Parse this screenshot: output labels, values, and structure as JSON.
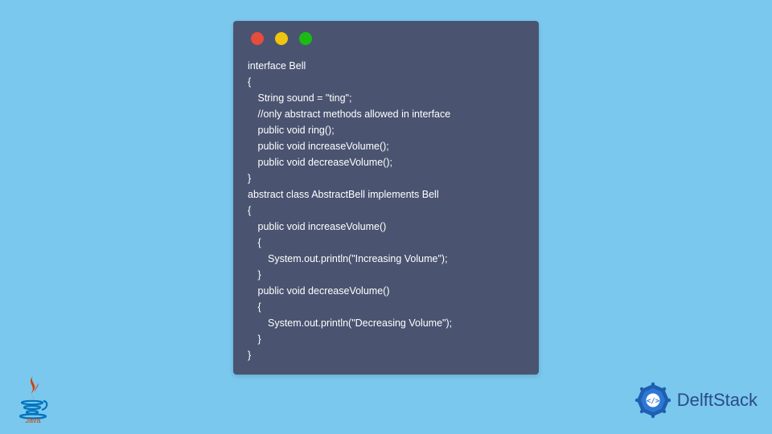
{
  "window": {
    "traffic": [
      "red",
      "yellow",
      "green"
    ]
  },
  "code_lines": [
    "interface Bell",
    "{",
    " String sound = \"ting\";",
    " //only abstract methods allowed in interface",
    " public void ring(); ",
    " public void increaseVolume();",
    " public void decreaseVolume();",
    "}",
    "abstract class AbstractBell implements Bell",
    "{",
    " public void increaseVolume()",
    " {",
    "  System.out.println(\"Increasing Volume\");",
    " }",
    " public void decreaseVolume()",
    " {",
    "  System.out.println(\"Decreasing Volume\");",
    " }",
    "}"
  ],
  "brand": {
    "java_label": "Java",
    "delftstack_label": "DelftStack"
  }
}
